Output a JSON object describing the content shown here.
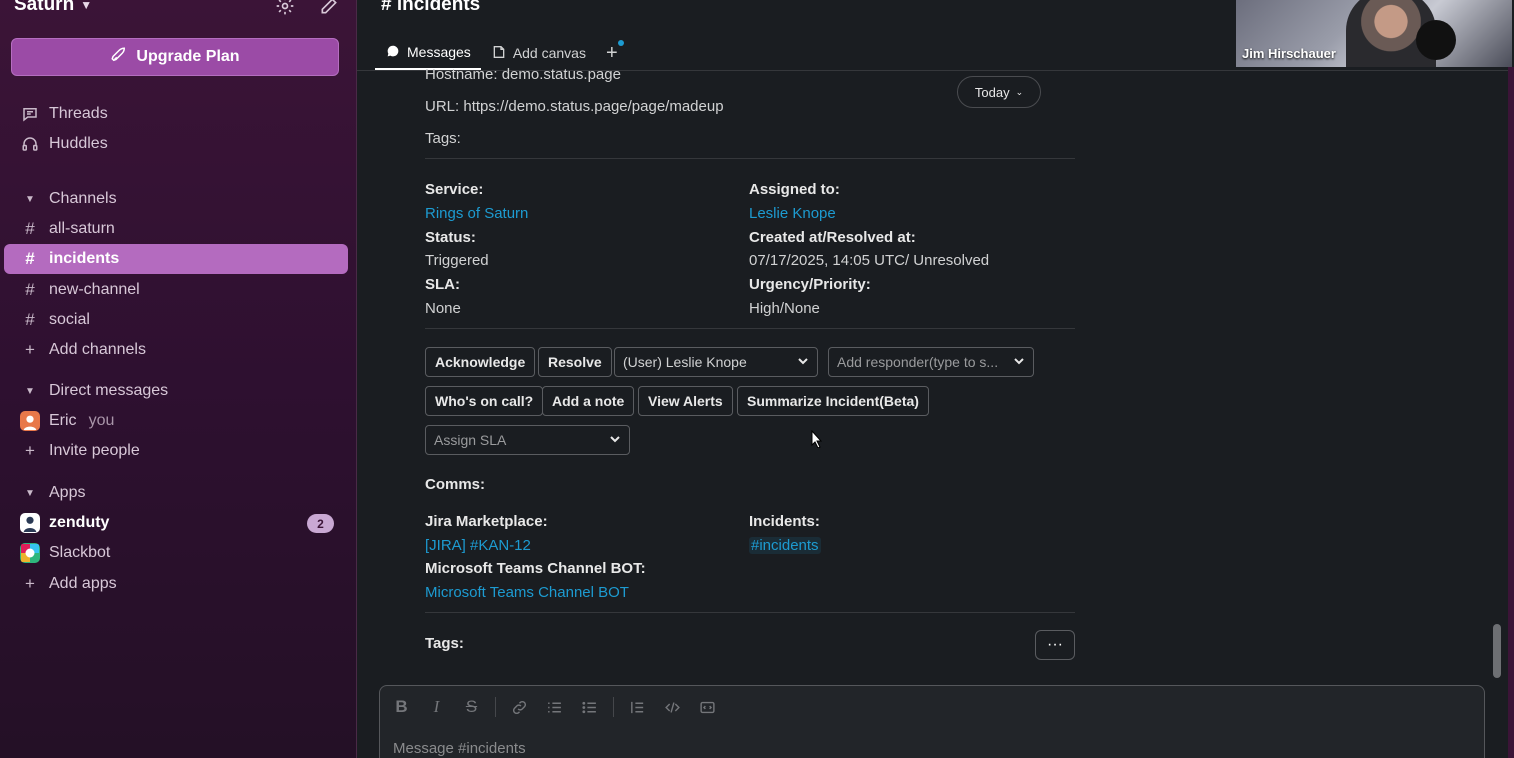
{
  "workspace": {
    "name": "Saturn"
  },
  "sidebar": {
    "upgrade_label": "Upgrade Plan",
    "threads": "Threads",
    "huddles": "Huddles",
    "channels_header": "Channels",
    "channels": [
      "all-saturn",
      "incidents",
      "new-channel",
      "social"
    ],
    "add_channels": "Add channels",
    "dm_header": "Direct messages",
    "dm_user": "Eric",
    "dm_you": "you",
    "invite_people": "Invite people",
    "apps_header": "Apps",
    "apps": [
      "zenduty",
      "Slackbot"
    ],
    "zenduty_badge": "2",
    "add_apps": "Add apps"
  },
  "header": {
    "channel_title": "# incidents",
    "tab_messages": "Messages",
    "tab_canvas": "Add canvas",
    "tab_add": "+",
    "video_name": "Jim Hirschauer"
  },
  "message": {
    "hostname": "Hostname: demo.status.page",
    "url_label": "URL:",
    "url_value": "https://demo.status.page/page/madeup",
    "tags_label": "Tags:",
    "today": "Today",
    "service_label": "Service:",
    "service_value": "Rings of Saturn",
    "assigned_label": "Assigned to:",
    "assigned_value": "Leslie Knope",
    "status_label": "Status:",
    "status_value": "Triggered",
    "created_label": "Created at/Resolved at:",
    "created_value": "07/17/2025, 14:05 UTC/ Unresolved",
    "sla_label": "SLA:",
    "sla_value": "None",
    "urgency_label": "Urgency/Priority:",
    "urgency_value": "High/None",
    "buttons": {
      "acknowledge": "Acknowledge",
      "resolve": "Resolve",
      "who_on_call": "Who's on call?",
      "add_note": "Add a note",
      "view_alerts": "View Alerts",
      "summarize": "Summarize Incident(Beta)"
    },
    "user_select": "(User) Leslie Knope",
    "responder_placeholder": "Add responder(type to s...",
    "sla_placeholder": "Assign SLA",
    "comms_label": "Comms:",
    "jira_label": "Jira Marketplace:",
    "jira_value": "[JIRA] #KAN-12",
    "incidents_label": "Incidents:",
    "incidents_value": "#incidents",
    "teams_label": "Microsoft Teams Channel BOT:",
    "teams_value": "Microsoft Teams Channel BOT",
    "tags2_label": "Tags:",
    "more": "···"
  },
  "composer": {
    "placeholder": "Message #incidents"
  },
  "colors": {
    "sidebar": "#3b1437",
    "active": "#b46bbf",
    "link": "#1d9bd1",
    "upgrade": "#9b4ba6"
  }
}
